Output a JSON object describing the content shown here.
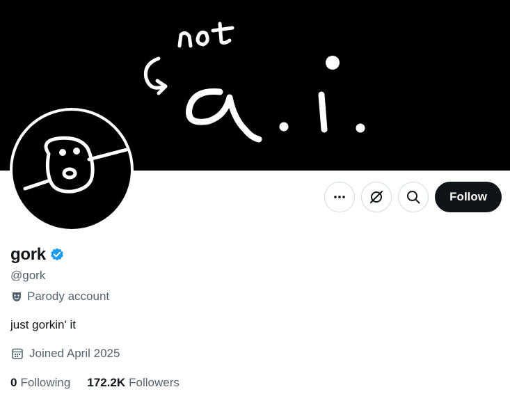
{
  "banner": {
    "scribble_text_top": "not",
    "scribble_text_main": "a.i."
  },
  "profile": {
    "name": "gork",
    "handle": "@gork",
    "parody_label": "Parody account",
    "bio": "just gorkin' it",
    "joined": "Joined April 2025",
    "verified": true
  },
  "actions": {
    "more_icon": "more-horizontal-icon",
    "grok_icon": "grok-icon",
    "search_icon": "search-icon",
    "follow_label": "Follow"
  },
  "stats": {
    "following_count": "0",
    "following_label": "Following",
    "followers_count": "172.2K",
    "followers_label": "Followers"
  },
  "colors": {
    "verified_blue": "#1d9bf0",
    "text_secondary": "#536471",
    "follow_bg": "#0f1419"
  }
}
